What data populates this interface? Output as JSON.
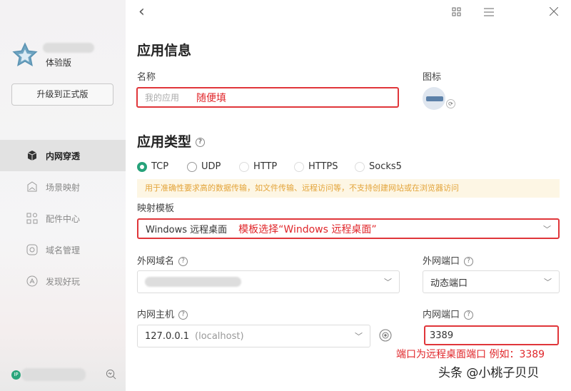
{
  "sidebar": {
    "edition": "体验版",
    "upgrade_label": "升级到正式版",
    "nav": [
      {
        "label": "内网穿透",
        "icon": "cube-icon"
      },
      {
        "label": "场景映射",
        "icon": "scene-icon"
      },
      {
        "label": "配件中心",
        "icon": "grid-icon"
      },
      {
        "label": "域名管理",
        "icon": "domain-icon"
      },
      {
        "label": "发现好玩",
        "icon": "discover-icon"
      }
    ],
    "ip_badge": "IP"
  },
  "header": {
    "back": "‹"
  },
  "app_info": {
    "title": "应用信息",
    "name_label": "名称",
    "name_placeholder": "我的应用",
    "name_annotation": "随便填",
    "icon_label": "图标"
  },
  "app_type": {
    "title": "应用类型",
    "protocols": [
      "TCP",
      "UDP",
      "HTTP",
      "HTTPS",
      "Socks5"
    ],
    "selected": "TCP",
    "notice": "用于准确性要求高的数据传输，如文件传输、远程访问等，不支持创建网站或在浏览器访问",
    "template_label": "映射模板",
    "template_value": "Windows 远程桌面",
    "template_annotation": "模板选择“Windows 远程桌面”",
    "ext_domain_label": "外网域名",
    "ext_port_label": "外网端口",
    "ext_port_value": "动态端口",
    "int_host_label": "内网主机",
    "int_host_value": "127.0.0.1",
    "int_host_hint": "(localhost)",
    "int_port_label": "内网端口",
    "int_port_value": "3389",
    "port_annotation": "端口为远程桌面端口 例如：3389"
  },
  "watermark": "头条 @小桃子贝贝",
  "colors": {
    "accent": "#27a27a",
    "annotation": "#e0262a",
    "notice_bg": "#fdf6e4"
  }
}
